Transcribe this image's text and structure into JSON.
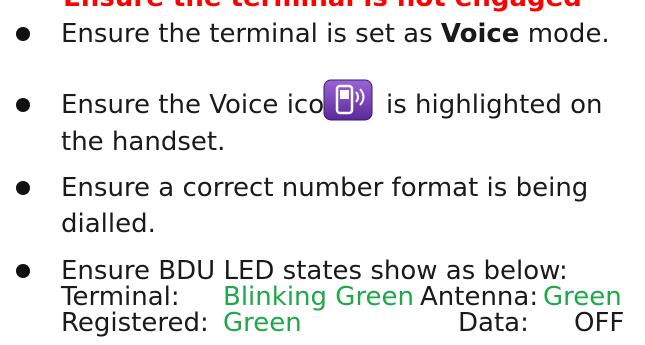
{
  "heading_fragment": "Ensure the terminal is not engaged",
  "items": [
    {
      "pre": "Ensure the terminal is set as ",
      "bold": "Voice",
      "post": " mode."
    },
    {
      "pre": "Ensure the Voice icon",
      "icon": "voice-mode-handset-icon",
      "post": "is highlighted on",
      "cont": "the handset."
    },
    {
      "line1": "Ensure a correct number format is being",
      "line2": "dialled."
    },
    {
      "line1": "Ensure BDU LED states show as below:",
      "leds": {
        "terminal_label": "Terminal:",
        "terminal_value": "Blinking Green",
        "antenna_label": "Antenna:",
        "antenna_value": "Green",
        "registered_label": "Registered:",
        "registered_value": "Green",
        "data_label": "Data:",
        "data_value": "OFF"
      }
    }
  ],
  "colors": {
    "heading": "#ff0000",
    "led_on": "#1fa84a",
    "text": "#1a1a1a",
    "icon_bg": "#7b3fbf"
  }
}
